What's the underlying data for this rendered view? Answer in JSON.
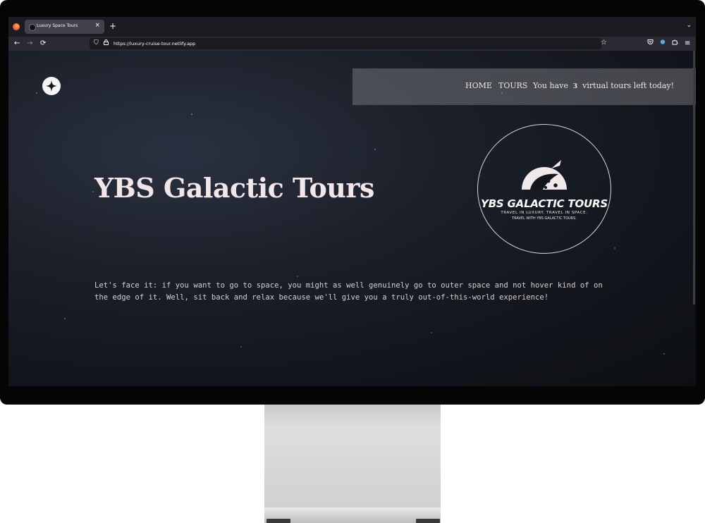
{
  "browser": {
    "tab_title": "Luxury Space Tours",
    "tab_close": "×",
    "new_tab": "+",
    "url": "https://luxury-cruise-tour.netlify.app"
  },
  "icons": {
    "back": "←",
    "forward": "→",
    "reload": "⟳",
    "star": "☆",
    "menu": "≡",
    "tab_list": "⌄",
    "shield": "⛉",
    "lock": "🔒"
  },
  "nav": {
    "home": "HOME",
    "tours": "TOURS",
    "tours_left_prefix": "You have",
    "tours_left_count": "3",
    "tours_left_suffix": "virtual tours left today!"
  },
  "hero": {
    "title": "YBS Galactic Tours",
    "description": "Let's face it: if you want to go to space, you might as well genuinely go to outer space and not hover kind of on the edge of it. Well, sit back and relax because we'll give you a truly out-of-this-world experience!"
  },
  "badge": {
    "title": "YBS GALACTIC TOURS",
    "tagline": "TRAVEL IN LUXURY. TRAVEL IN SPACE.",
    "tagline2": "TRAVEL WITH YBS GALACTIC TOURS."
  },
  "colors": {
    "page_background": "#14161b",
    "text_light": "#f2e6e8",
    "nav_panel": "#8c8c91"
  }
}
